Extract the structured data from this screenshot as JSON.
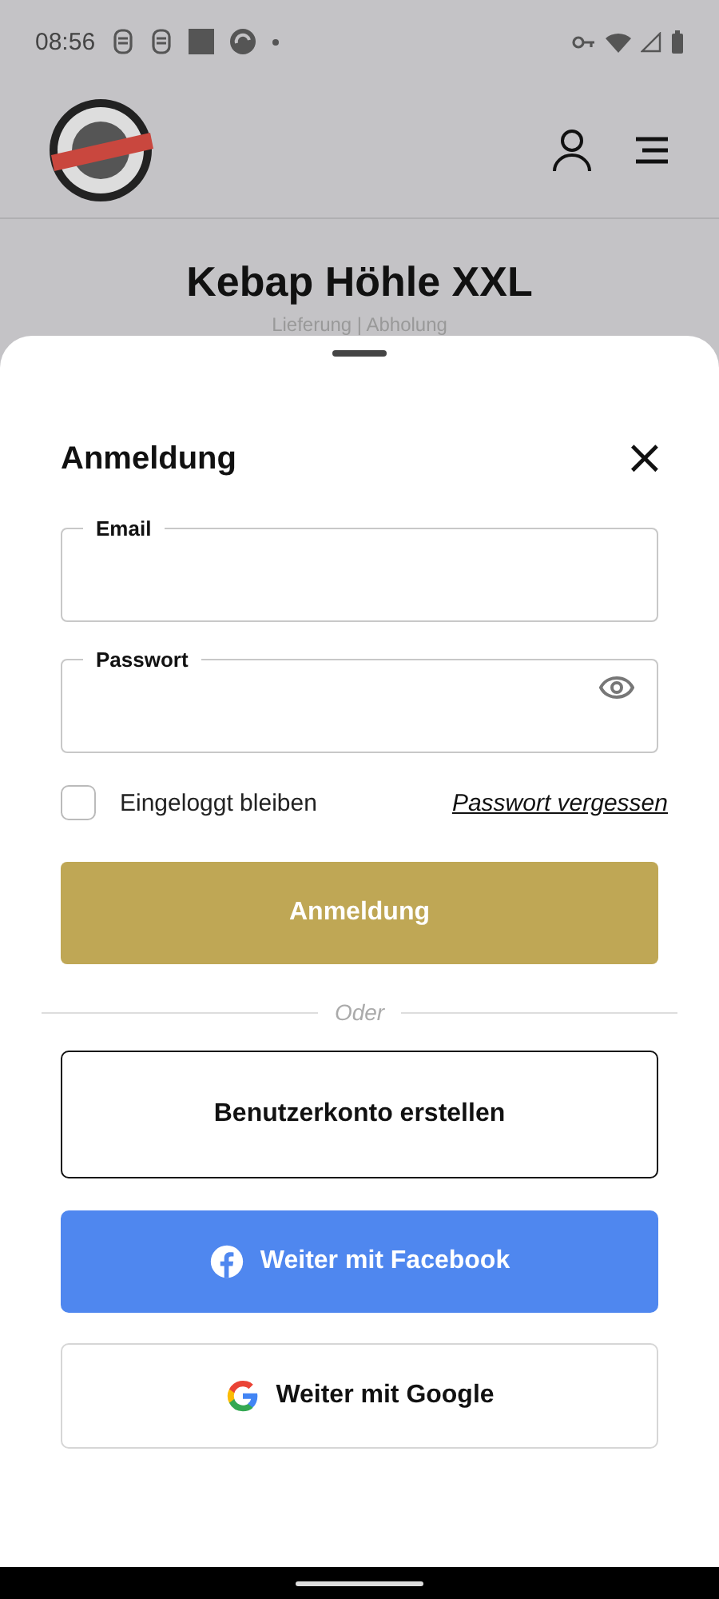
{
  "status_bar": {
    "time": "08:56"
  },
  "header": {
    "title": "Kebap Höhle XXL",
    "subtitle": "Lieferung | Abholung"
  },
  "sheet": {
    "title": "Anmeldung",
    "close": "×",
    "fields": [
      {
        "kind": "text",
        "label": "Email"
      },
      {
        "kind": "password",
        "label": "Passwort"
      }
    ],
    "remember": {
      "label": "Eingeloggt bleiben",
      "checked": false
    },
    "forgot_link": "Passwort vergessen",
    "login_button": "Anmeldung",
    "divider": "Oder",
    "buttons": [
      {
        "kind": "outline",
        "label": "Benutzerkonto erstellen"
      },
      {
        "kind": "facebook",
        "label": "Weiter mit Facebook"
      },
      {
        "kind": "google",
        "label": "Weiter mit Google"
      }
    ]
  }
}
